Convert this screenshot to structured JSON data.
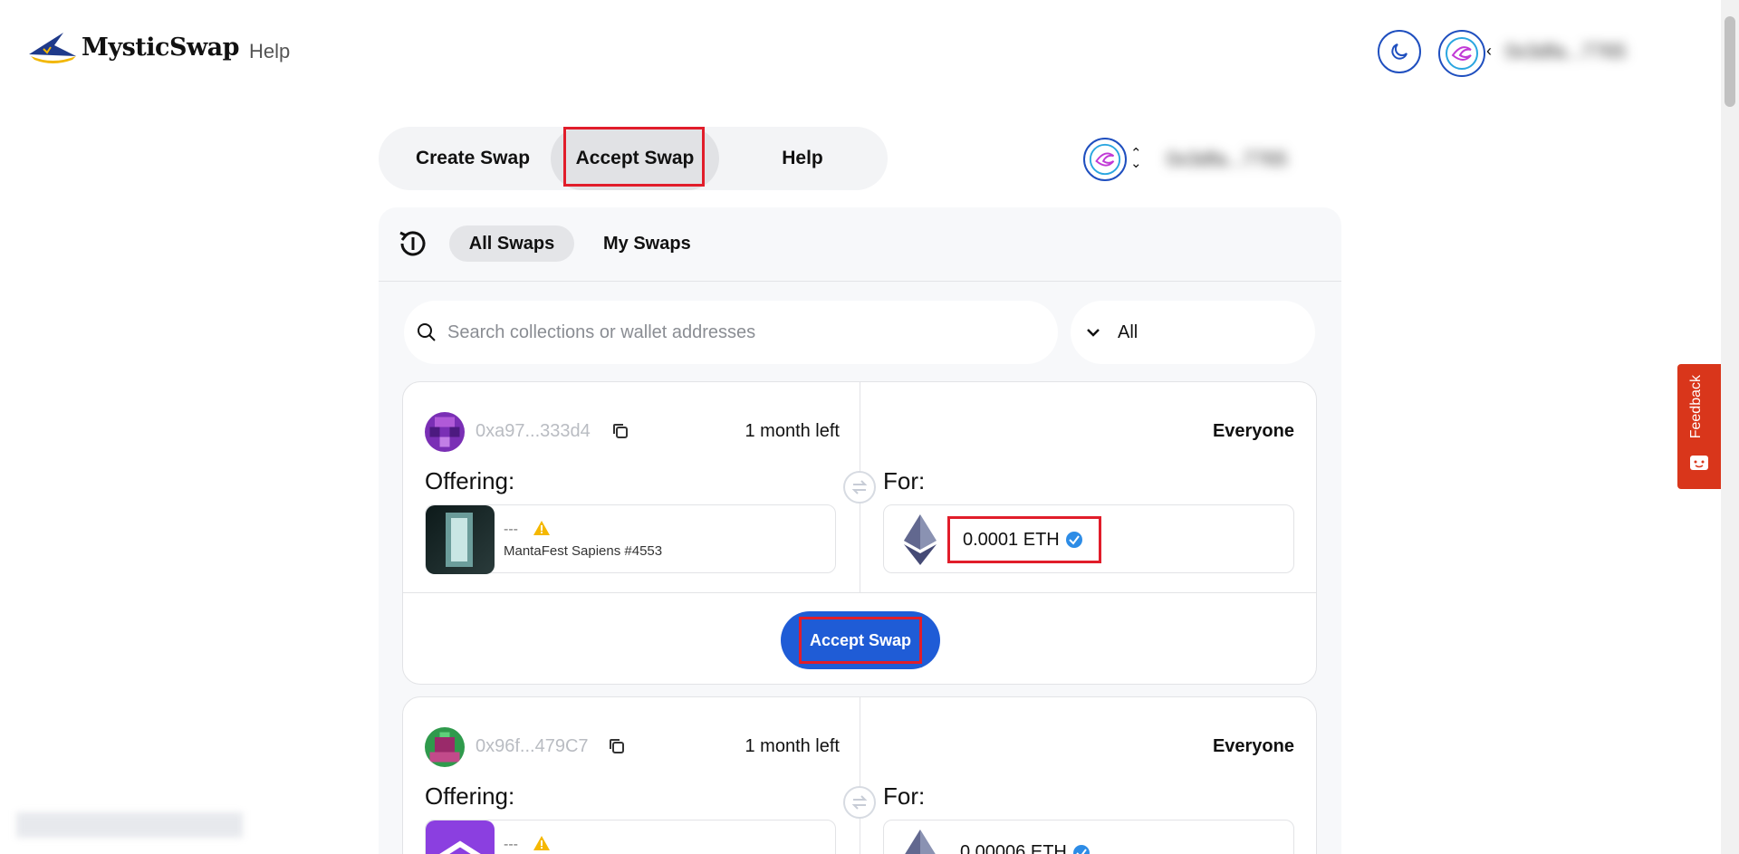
{
  "header": {
    "app_name": "MysticSwap",
    "help_label": "Help",
    "account_address": "0x3dfa...7765"
  },
  "tabs": [
    {
      "label": "Create Swap"
    },
    {
      "label": "Accept Swap"
    },
    {
      "label": "Help"
    }
  ],
  "chain": {
    "address": "0x3dfa...7765"
  },
  "subtabs": {
    "all_label": "All Swaps",
    "my_label": "My Swaps"
  },
  "search": {
    "placeholder": "Search collections or wallet addresses"
  },
  "filter": {
    "value": "All"
  },
  "swaps": [
    {
      "address": "0xa97...333d4",
      "time_left": "1 month left",
      "audience": "Everyone",
      "offering_label": "Offering:",
      "for_label": "For:",
      "nft_collection": "---",
      "nft_name": "MantaFest Sapiens #4553",
      "price": "0.0001 ETH",
      "accept_label": "Accept Swap"
    },
    {
      "address": "0x96f...479C7",
      "time_left": "1 month left",
      "audience": "Everyone",
      "offering_label": "Offering:",
      "for_label": "For:",
      "nft_collection": "---",
      "price": "0.00006 ETH"
    }
  ],
  "feedback": {
    "label": "Feedback"
  },
  "colors": {
    "primary": "#1f5cd6",
    "highlight": "#e11d2a",
    "feedback": "#d9361b"
  }
}
